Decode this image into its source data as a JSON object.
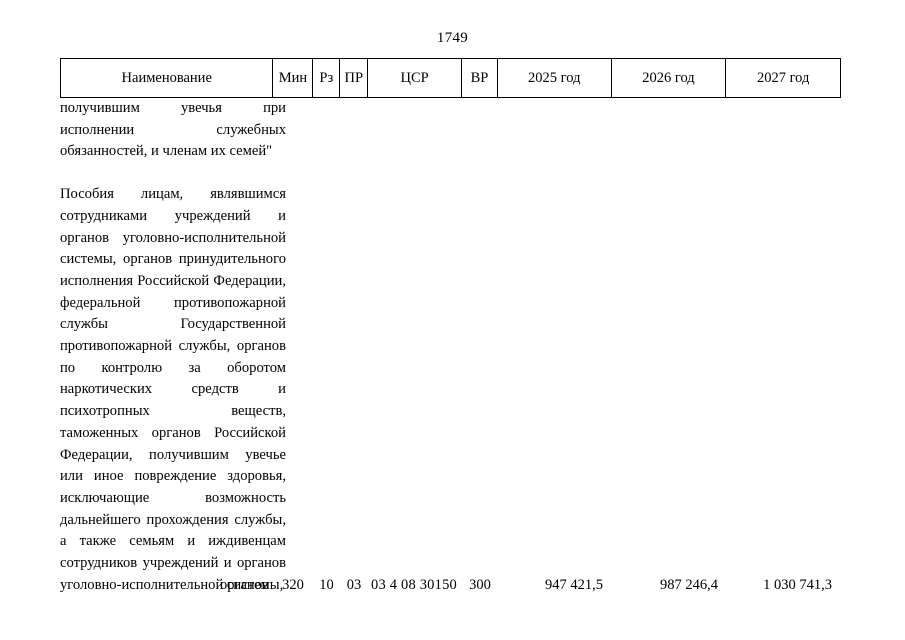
{
  "document": {
    "page_number": "1749"
  },
  "table": {
    "header": [
      {
        "key": "name",
        "label": "Наименование"
      },
      {
        "key": "min",
        "label": "Мин"
      },
      {
        "key": "rz",
        "label": "Рз"
      },
      {
        "key": "pr",
        "label": "ПР"
      },
      {
        "key": "csr",
        "label": "ЦСР"
      },
      {
        "key": "vr",
        "label": "ВР"
      },
      {
        "key": "y2025",
        "label": "2025 год"
      },
      {
        "key": "y2026",
        "label": "2026 год"
      },
      {
        "key": "y2027",
        "label": "2027 год"
      }
    ],
    "name_column": {
      "continued_paragraph": "получившим увечья при исполнении служебных обязанностей, и членам их семей\"",
      "paragraph": "Пособия лицам, являвшимся сотрудниками учреждений и органов уголовно-исполнительной системы, органов принудительного исполнения Российской Федерации, федеральной противопожарной службы Государственной противопожарной службы, органов по контролю за оборотом наркотических средств и психотропных веществ, таможенных органов Российской Федерации, получившим увечье или иное повреждение здоровья, исключающие возможность дальнейшего прохождения службы, а также семьям и иждивенцам сотрудников учреждений и органов уголовно-исполнительной системы,",
      "paragraph_last_line": "органов"
    },
    "data_row": {
      "min": "320",
      "rz": "10",
      "pr": "03",
      "csr": "03 4 08 30150",
      "vr": "300",
      "y2025": "947 421,5",
      "y2026": "987 246,4",
      "y2027": "1 030 741,3"
    }
  }
}
